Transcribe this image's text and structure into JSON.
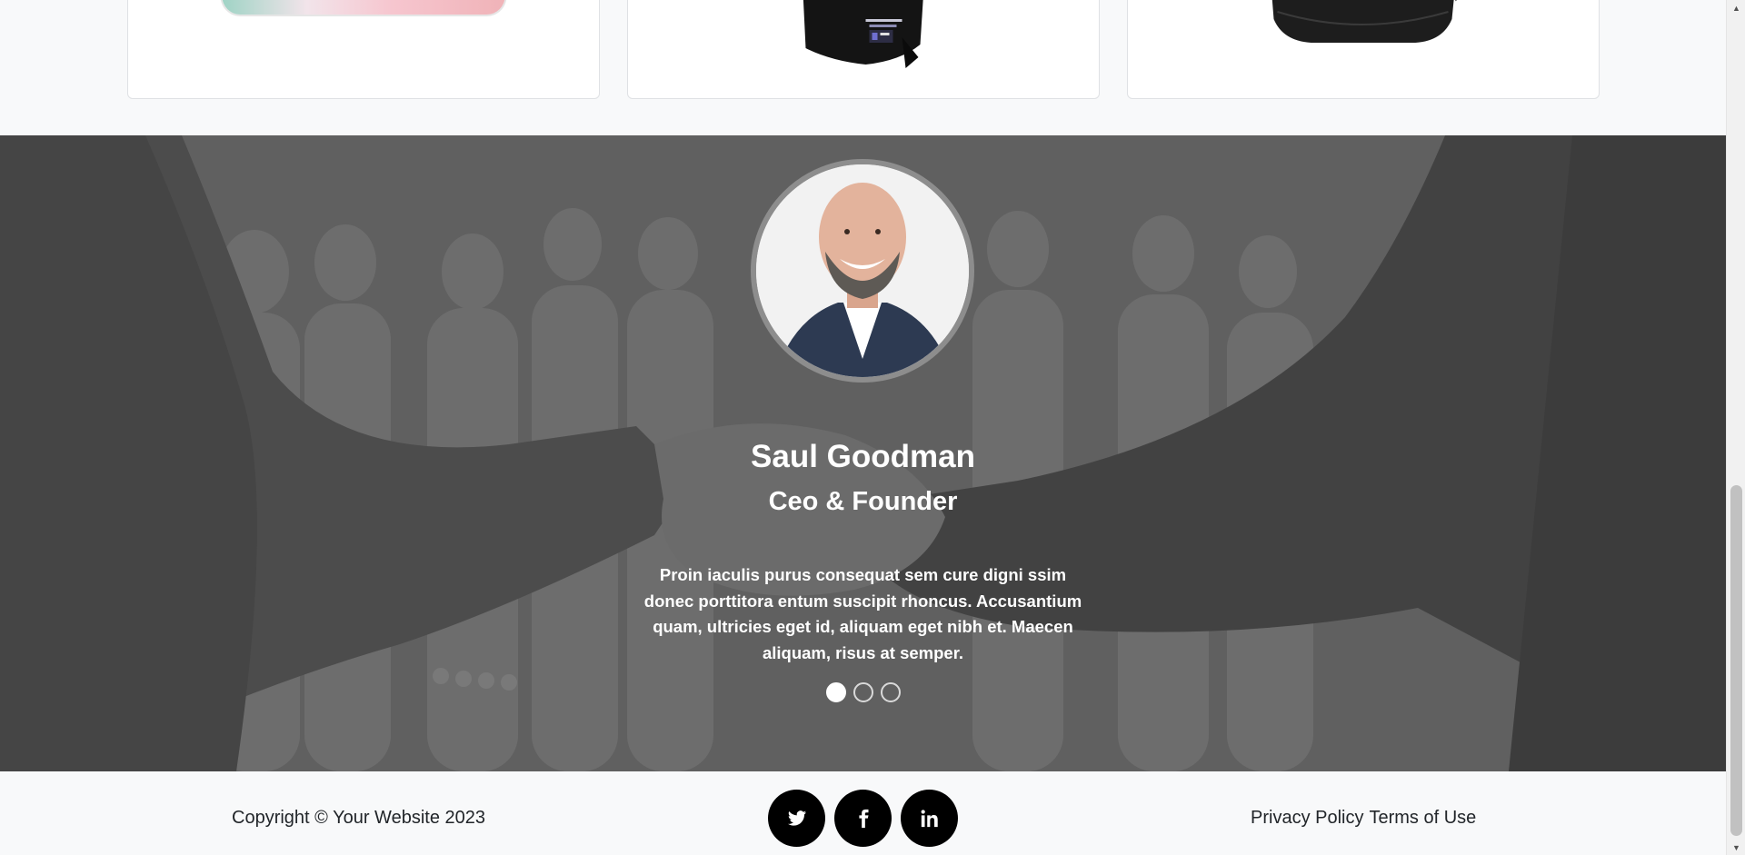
{
  "products": {
    "items": [
      {
        "icon": "shoe-image"
      },
      {
        "icon": "jersey-image"
      },
      {
        "icon": "bag-image"
      }
    ]
  },
  "testimonial": {
    "name": "Saul Goodman",
    "role": "Ceo & Founder",
    "quote": "Proin iaculis purus consequat sem cure digni ssim donec porttitora entum suscipit rhoncus. Accusantium quam, ultricies eget id, aliquam eget nibh et. Maecen aliquam, risus at semper.",
    "indicators": {
      "count": 3,
      "active_index": 0
    }
  },
  "footer": {
    "copyright": "Copyright © Your Website 2023",
    "social": [
      {
        "icon": "twitter-icon"
      },
      {
        "icon": "facebook-icon"
      },
      {
        "icon": "linkedin-icon"
      }
    ],
    "links": {
      "privacy": "Privacy Policy",
      "terms": "Terms of Use"
    }
  },
  "colors": {
    "page_bg": "#f8f9fa",
    "overlay": "#6c6c6c",
    "text_dark": "#212529",
    "social_bg": "#000000",
    "white": "#ffffff"
  }
}
